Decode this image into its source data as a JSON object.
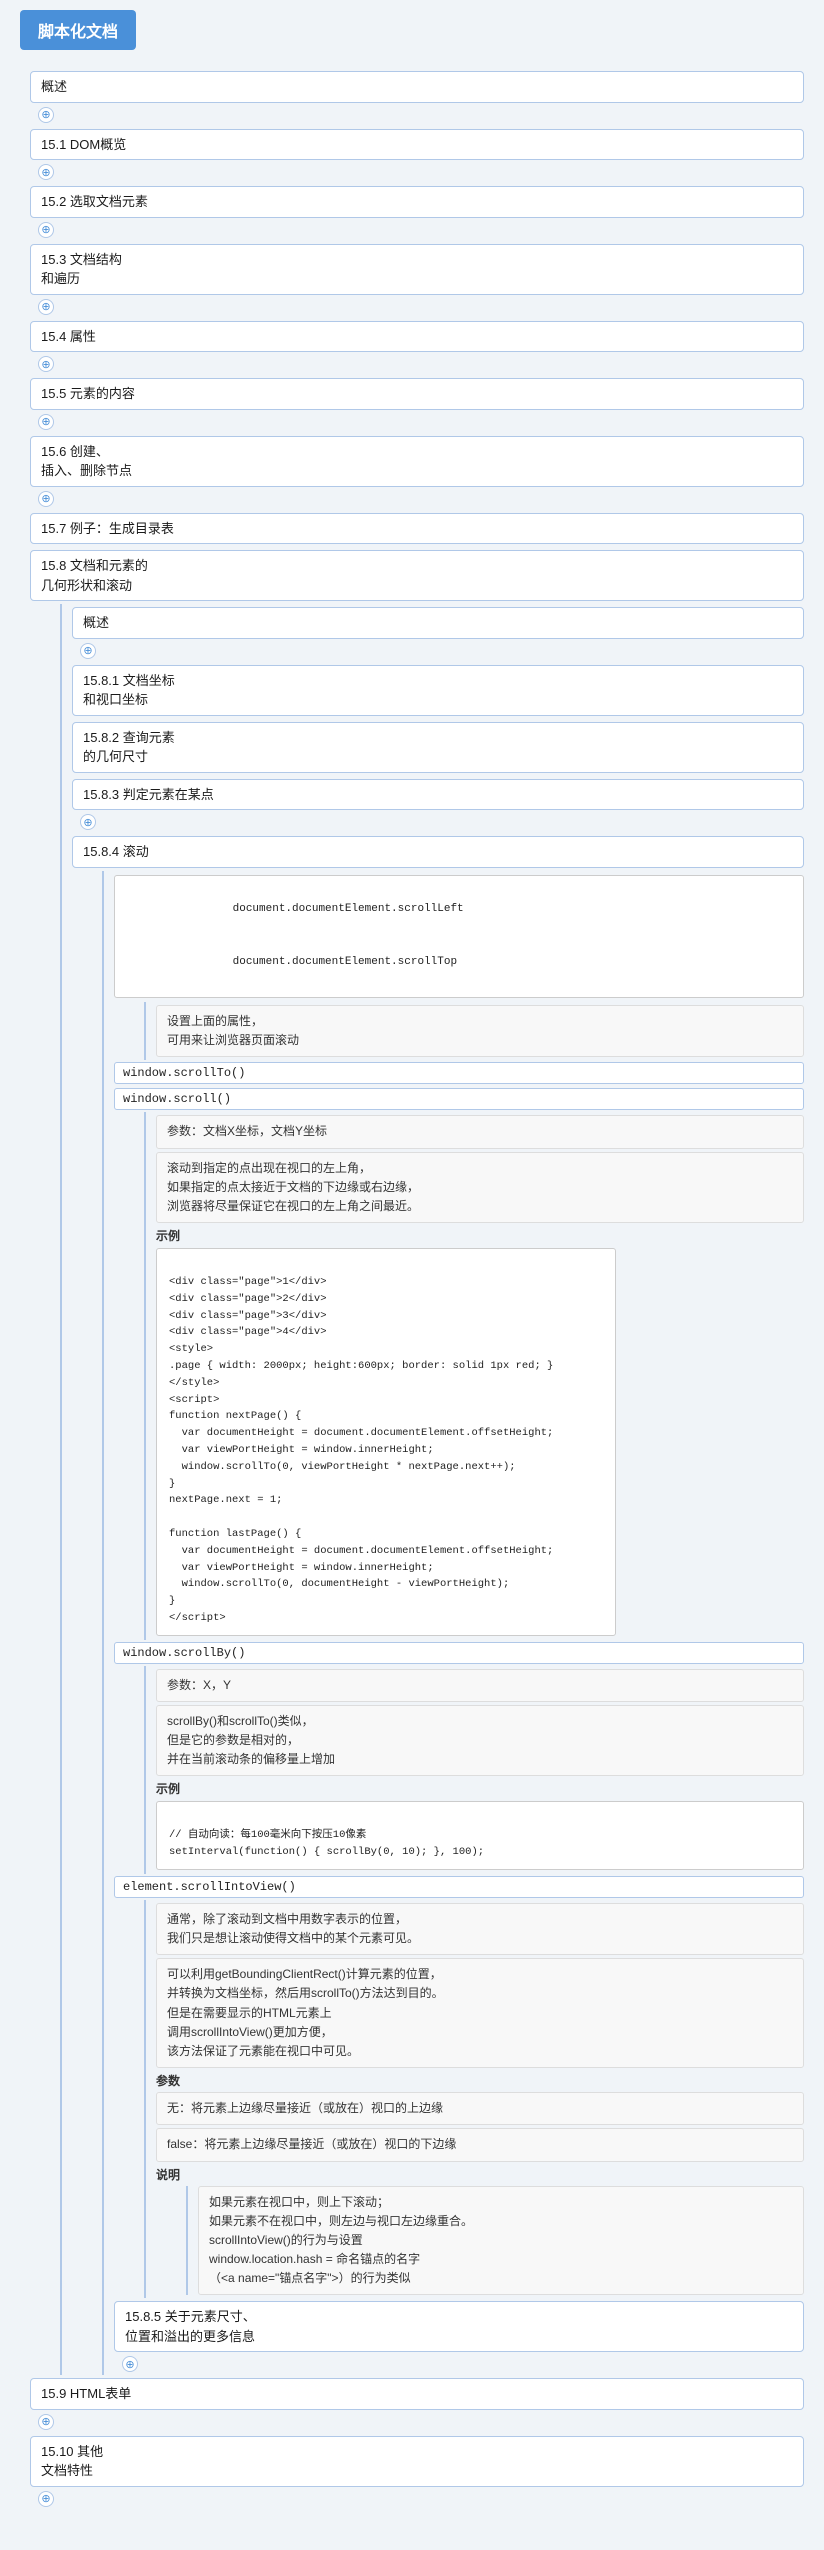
{
  "title": "脚本化文档",
  "toc": {
    "items": [
      {
        "id": "overview",
        "label": "概述",
        "hasExpand": true
      },
      {
        "id": "s15_1",
        "label": "15.1 DOM概览",
        "hasExpand": true
      },
      {
        "id": "s15_2",
        "label": "15.2 选取文档元素",
        "hasExpand": true
      },
      {
        "id": "s15_3",
        "label": "15.3 文档结构\n和遍历",
        "hasExpand": true
      },
      {
        "id": "s15_4",
        "label": "15.4 属性",
        "hasExpand": true
      },
      {
        "id": "s15_5",
        "label": "15.5 元素的内容",
        "hasExpand": true
      },
      {
        "id": "s15_6",
        "label": "15.6 创建、\n插入、删除节点",
        "hasExpand": true
      },
      {
        "id": "s15_7",
        "label": "15.7 例子：生成目录表",
        "hasExpand": false
      },
      {
        "id": "s15_8",
        "label": "15.8 文档和元素的\n几何形状和滚动",
        "hasExpand": false,
        "expanded": true
      }
    ]
  },
  "s15_8": {
    "overview_label": "概述",
    "overview_expand": true,
    "sub_items": [
      {
        "id": "s15_8_1",
        "label": "15.8.1 文档坐标\n和视口坐标",
        "hasExpand": false
      },
      {
        "id": "s15_8_2",
        "label": "15.8.2 查询元素\n的几何尺寸",
        "hasExpand": false
      },
      {
        "id": "s15_8_3",
        "label": "15.8.3 判定元素在某点",
        "hasExpand": true
      },
      {
        "id": "s15_8_4",
        "label": "15.8.4 滚动",
        "hasExpand": false,
        "expanded": true
      }
    ],
    "scroll_props": {
      "prop1": "document.documentElement.scrollLeft",
      "prop2": "document.documentElement.scrollTop",
      "annotation": "设置上面的属性，\n可用来让浏览器页面滚动"
    },
    "scroll_methods": {
      "m1": "window.scrollTo()",
      "m2": "window.scroll()",
      "params_label": "参数：文档X坐标，文档Y坐标",
      "desc": "滚动到指定的点出现在视口的左上角，\n如果指定的点太接近于文档的下边缘或右边缘，\n浏览器将尽量保证它在视口的左上角之间最近。",
      "example_label": "示例"
    },
    "code_example1": "<div class=\"page\">1</div>\n<div class=\"page\">2</div>\n<div class=\"page\">3</div>\n<div class=\"page\">4</div>\n<style>\n.page { width: 2000px; height:600px; border: solid 1px red; }\n</style>\n<script>\nfunction nextPage() {\n  var documentHeight = document.documentElement.offsetHeight;\n  var viewPortHeight = window.innerHeight;\n  window.scrollTo(0, viewPortHeight * nextPage.next++);\n}\nnextPage.next = 1;\n\nfunction lastPage() {\n  var documentHeight = document.documentElement.offsetHeight;\n  var viewPortHeight = window.innerHeight;\n  window.scrollTo(0, documentHeight - viewPortHeight);\n}\n</script>",
    "scrollBy": {
      "method": "window.scrollBy()",
      "params_label": "参数：X，Y",
      "desc": "scrollBy()和scrollTo()类似，\n但是它的参数是相对的，\n并在当前滚动条的偏移量上增加",
      "example_label": "示例"
    },
    "code_example2": "// 自动向读：每100毫米向下按压10像素\nsetInterval(function() { scrollBy(0, 10); }, 100);",
    "scrollIntoView": {
      "method": "element.scrollIntoView()",
      "desc1": "通常，除了滚动到文档中用数字表示的位置，\n我们只是想让滚动使得文档中的某个元素可见。",
      "desc2": "可以利用getBoundingClientRect()计算元素的位置，\n并转换为文档坐标，然后用scrollTo()方法达到目的。\n但是在需要显示的HTML元素上\n调用scrollIntoView()更加方便，\n该方法保证了元素能在视口中可见。",
      "params_title": "参数",
      "param_none": "无：将元素上边缘尽量接近（或放在）视口的上边缘",
      "param_false": "false：将元素上边缘尽量接近（或放在）视口的下边缘",
      "desc_title": "说明",
      "desc3": "如果元素在视口中，则上下滚动；\n如果元素不在视口中，则左边与视口左边缘重合。\nscrollIntoView()的行为与设置\nwindow.location.hash = 命名锚点的名字\n（<a name=\"锚点名字\">）的行为类似"
    },
    "s15_8_5_label": "15.8.5 关于元素尺寸、\n位置和溢出的更多信息",
    "s15_8_5_expand": true
  },
  "bottom_items": [
    {
      "id": "s15_9",
      "label": "15.9 HTML表单",
      "hasExpand": true
    },
    {
      "id": "s15_10",
      "label": "15.10 其他\n文档特性",
      "hasExpand": true
    }
  ],
  "icons": {
    "expand": "⊕",
    "collapse": "⊖"
  }
}
